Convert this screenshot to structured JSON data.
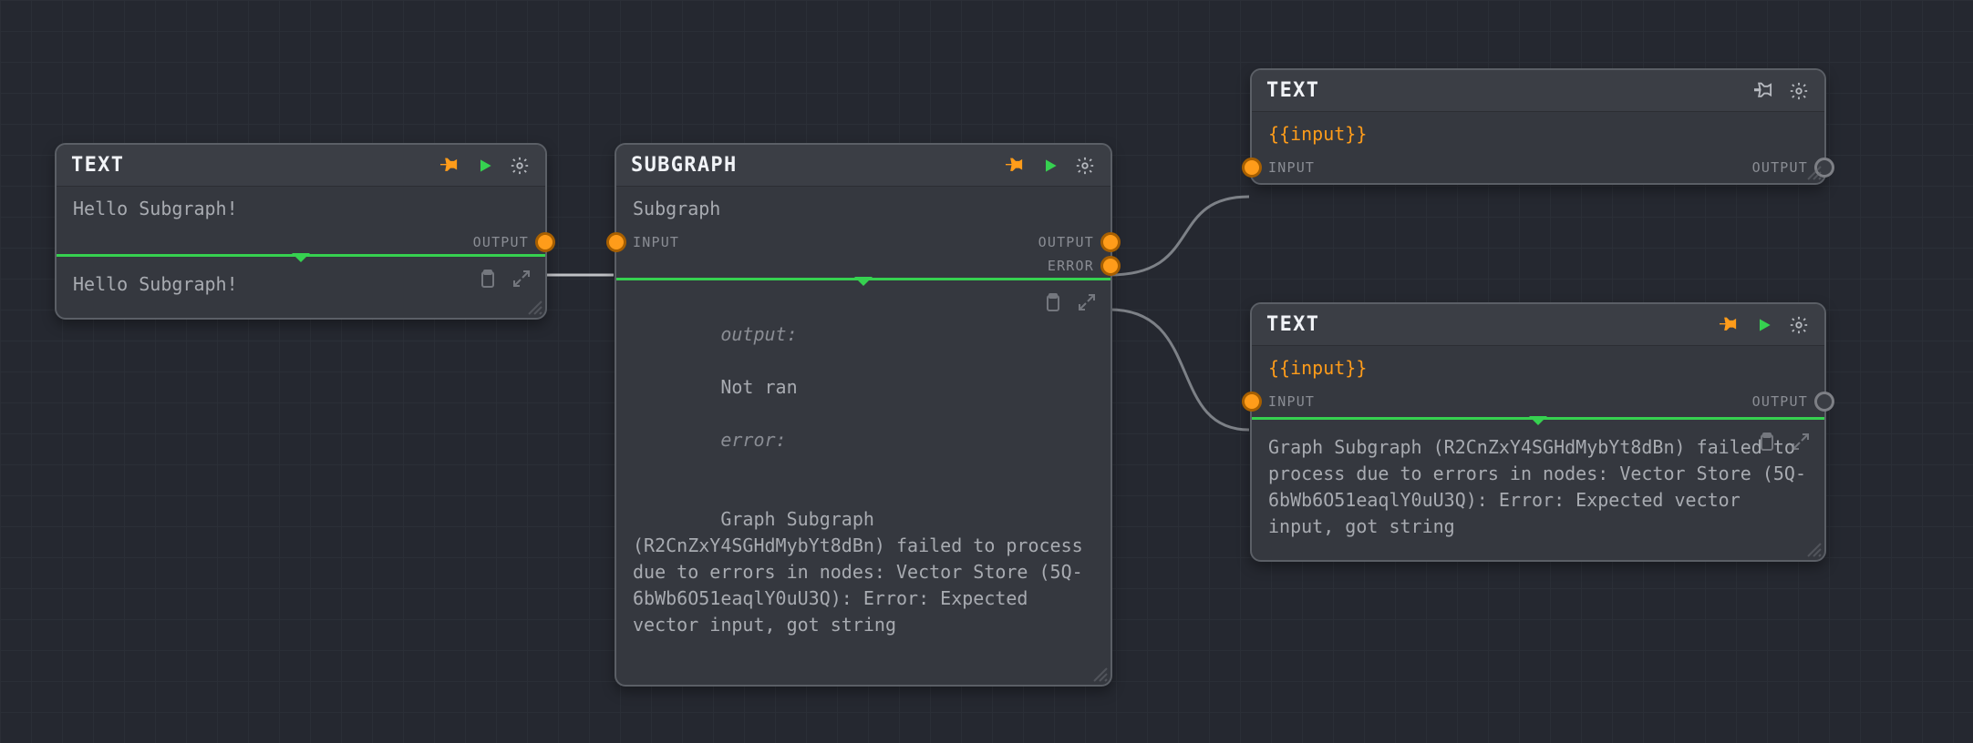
{
  "nodes": {
    "text1": {
      "title": "TEXT",
      "body": "Hello Subgraph!",
      "outputLabel": "OUTPUT",
      "result": "Hello Subgraph!"
    },
    "subgraph": {
      "title": "SUBGRAPH",
      "body": "Subgraph",
      "inputLabel": "INPUT",
      "outputLabel": "OUTPUT",
      "errorLabel": "ERROR",
      "result_output_label": "output:",
      "result_output_value": "Not ran",
      "result_error_label": "error:",
      "result_error_value": "Graph Subgraph (R2CnZxY4SGHdMybYt8dBn) failed to process due to errors in nodes: Vector Store (5Q-6bWb6O51eaqlY0uU3Q): Error: Expected vector input, got string"
    },
    "text2": {
      "title": "TEXT",
      "body": "{{input}}",
      "inputLabel": "INPUT",
      "outputLabel": "OUTPUT"
    },
    "text3": {
      "title": "TEXT",
      "body": "{{input}}",
      "inputLabel": "INPUT",
      "outputLabel": "OUTPUT",
      "result": "Graph Subgraph (R2CnZxY4SGHdMybYt8dBn) failed to process due to errors in nodes: Vector Store (5Q-6bWb6O51eaqlY0uU3Q): Error: Expected vector input, got string"
    }
  },
  "icons": {
    "pin": "pin-icon",
    "play": "play-icon",
    "gear": "gear-icon",
    "clipboard": "clipboard-icon",
    "expand": "expand-icon"
  }
}
